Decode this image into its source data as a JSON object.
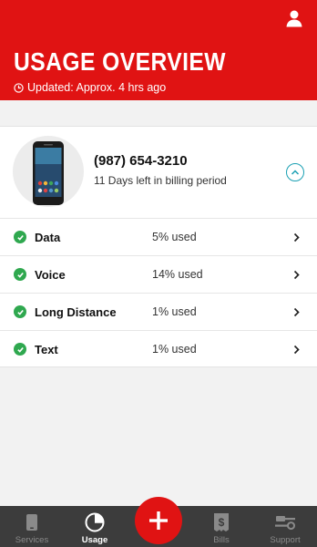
{
  "header": {
    "title": "USAGE OVERVIEW",
    "updated": "Updated: Approx. 4 hrs ago",
    "profile_icon": "user-icon",
    "bg_color": "#e01313"
  },
  "device": {
    "phone_number": "(987) 654-3210",
    "billing_text": "11 Days left in billing period",
    "image_icon": "smartphone-image",
    "toggle_icon": "chevron-up-circle-icon"
  },
  "usage": [
    {
      "label": "Data",
      "value": "5% used",
      "status_icon": "check-circle-icon"
    },
    {
      "label": "Voice",
      "value": "14% used",
      "status_icon": "check-circle-icon"
    },
    {
      "label": "Long Distance",
      "value": "1% used",
      "status_icon": "check-circle-icon"
    },
    {
      "label": "Text",
      "value": "1% used",
      "status_icon": "check-circle-icon"
    }
  ],
  "tabs": [
    {
      "label": "Services",
      "icon": "phone-icon",
      "active": false
    },
    {
      "label": "Usage",
      "icon": "pie-chart-icon",
      "active": true
    },
    {
      "label": "Bills",
      "icon": "bill-icon",
      "active": false
    },
    {
      "label": "Support",
      "icon": "tools-icon",
      "active": false
    }
  ],
  "fab": {
    "icon": "plus-icon",
    "color": "#e01313"
  }
}
